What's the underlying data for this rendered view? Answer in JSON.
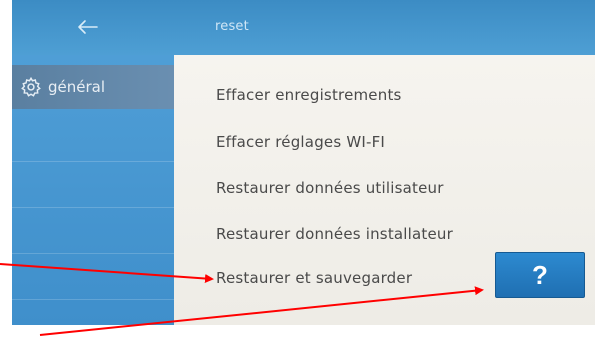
{
  "header": {
    "title": "reset",
    "back_icon": "arrow-left-icon",
    "background_color": "#4a9ad1"
  },
  "sidebar": {
    "items": [
      {
        "label": "général",
        "icon": "gear-icon",
        "selected": true
      }
    ]
  },
  "menu": {
    "items": [
      {
        "label": "Effacer enregistrements"
      },
      {
        "label": "Effacer réglages WI-FI"
      },
      {
        "label": "Restaurer données utilisateur"
      },
      {
        "label": "Restaurer données installateur"
      },
      {
        "label": "Restaurer et sauvegarder"
      }
    ]
  },
  "help_button": {
    "label": "?",
    "color": "#1f76bd"
  },
  "annotation": {
    "arrow_color": "#ff0000"
  }
}
